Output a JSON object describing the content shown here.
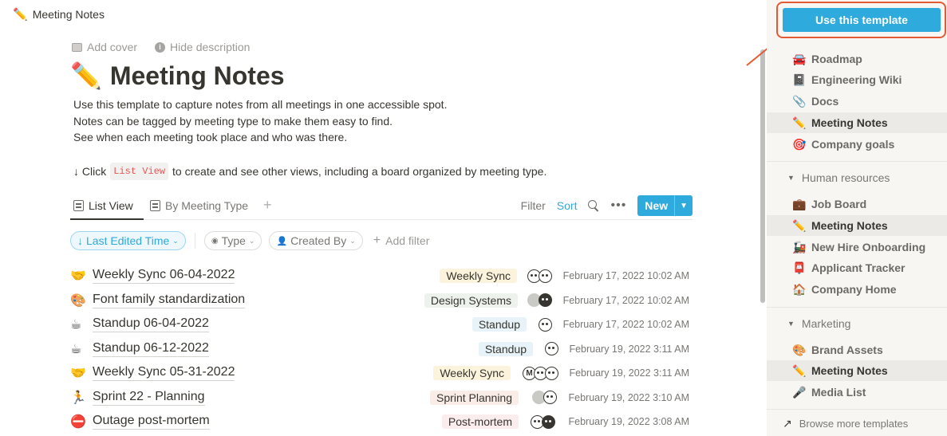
{
  "topbar": {
    "emoji": "✏️",
    "title": "Meeting Notes"
  },
  "page_actions": {
    "add_cover": "Add cover",
    "hide_description": "Hide description"
  },
  "page": {
    "emoji": "✏️",
    "title": "Meeting Notes",
    "description": [
      "Use this template to capture notes from all meetings in one accessible spot.",
      "Notes can be tagged by meeting type to make them easy to find.",
      "See when each meeting took place and who was there."
    ],
    "hint_prefix": "↓ Click",
    "hint_code": "List View",
    "hint_suffix": "to create and see other views, including a board organized by meeting type."
  },
  "views": {
    "tabs": [
      {
        "label": "List View",
        "active": true
      },
      {
        "label": "By Meeting Type",
        "active": false
      }
    ],
    "filter": "Filter",
    "sort": "Sort",
    "more": "•••",
    "new": "New"
  },
  "filters": {
    "sort_pill": "Last Edited Time",
    "type_pill": "Type",
    "created_by_pill": "Created By",
    "add_filter": "Add filter"
  },
  "rows": [
    {
      "emoji": "🤝",
      "name": "Weekly Sync 06-04-2022",
      "tag": "Weekly Sync",
      "date": "February 17, 2022 10:02 AM"
    },
    {
      "emoji": "🎨",
      "name": "Font family standardization",
      "tag": "Design Systems",
      "date": "February 17, 2022 10:02 AM"
    },
    {
      "emoji": "☕",
      "name": "Standup 06-04-2022",
      "tag": "Standup",
      "date": "February 17, 2022 10:02 AM"
    },
    {
      "emoji": "☕",
      "name": "Standup 06-12-2022",
      "tag": "Standup",
      "date": "February 19, 2022 3:11 AM"
    },
    {
      "emoji": "🤝",
      "name": "Weekly Sync 05-31-2022",
      "tag": "Weekly Sync",
      "date": "February 19, 2022 3:11 AM"
    },
    {
      "emoji": "🏃",
      "name": "Sprint 22 - Planning",
      "tag": "Sprint Planning",
      "date": "February 19, 2022 3:10 AM"
    },
    {
      "emoji": "⛔",
      "name": "Outage post-mortem",
      "tag": "Post-mortem",
      "date": "February 19, 2022 3:08 AM"
    }
  ],
  "tag_colors": {
    "Weekly Sync": "#fbf3db",
    "Design Systems": "#edf3ec",
    "Standup": "#e7f3f8",
    "Sprint Planning": "#faece7",
    "Post-mortem": "#fbecee"
  },
  "avatar_letter": "M",
  "sidebar": {
    "use_template": "Use this template",
    "group1": [
      {
        "emoji": "🚘",
        "label": "Roadmap",
        "active": false
      },
      {
        "emoji": "📓",
        "label": "Engineering Wiki",
        "active": false
      },
      {
        "emoji": "📎",
        "label": "Docs",
        "active": false
      },
      {
        "emoji": "✏️",
        "label": "Meeting Notes",
        "active": true
      },
      {
        "emoji": "🎯",
        "label": "Company goals",
        "active": false
      }
    ],
    "section_hr": "Human resources",
    "group2": [
      {
        "emoji": "💼",
        "label": "Job Board",
        "active": false
      },
      {
        "emoji": "✏️",
        "label": "Meeting Notes",
        "active": true
      },
      {
        "emoji": "🚂",
        "label": "New Hire Onboarding",
        "active": false
      },
      {
        "emoji": "📮",
        "label": "Applicant Tracker",
        "active": false
      },
      {
        "emoji": "🏠",
        "label": "Company Home",
        "active": false
      }
    ],
    "section_marketing": "Marketing",
    "group3": [
      {
        "emoji": "🎨",
        "label": "Brand Assets",
        "active": false
      },
      {
        "emoji": "✏️",
        "label": "Meeting Notes",
        "active": true
      },
      {
        "emoji": "🎤",
        "label": "Media List",
        "active": false
      }
    ],
    "browse": "Browse more templates"
  },
  "colors": {
    "accent": "#2eaadc",
    "highlight_border": "#e55a36"
  }
}
